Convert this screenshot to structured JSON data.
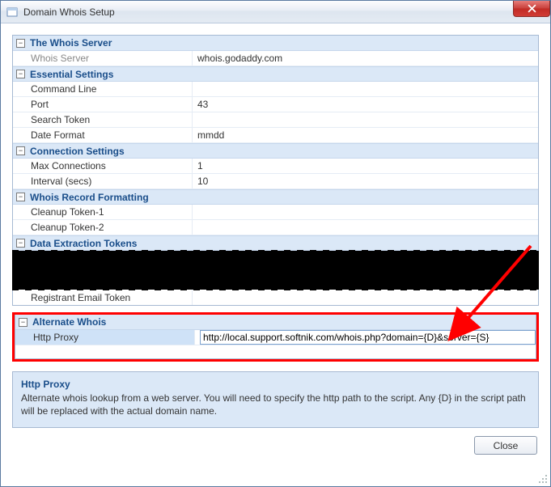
{
  "window": {
    "title": "Domain Whois Setup",
    "close_label": "Close"
  },
  "groups": {
    "whois_server": {
      "title": "The Whois Server",
      "rows": {
        "whois_server": {
          "label": "Whois Server",
          "value": "whois.godaddy.com"
        }
      }
    },
    "essential": {
      "title": "Essential Settings",
      "rows": {
        "command_line": {
          "label": "Command Line",
          "value": ""
        },
        "port": {
          "label": "Port",
          "value": "43"
        },
        "search_token": {
          "label": "Search Token",
          "value": ""
        },
        "date_format": {
          "label": "Date Format",
          "value": "mmdd"
        }
      }
    },
    "connection": {
      "title": "Connection Settings",
      "rows": {
        "max_connections": {
          "label": "Max Connections",
          "value": "1"
        },
        "interval": {
          "label": "Interval (secs)",
          "value": "10"
        }
      }
    },
    "formatting": {
      "title": "Whois Record Formatting",
      "rows": {
        "cleanup1": {
          "label": "Cleanup Token-1",
          "value": ""
        },
        "cleanup2": {
          "label": "Cleanup Token-2",
          "value": ""
        }
      }
    },
    "extraction": {
      "title": "Data Extraction Tokens",
      "rows": {
        "registrant_email": {
          "label": "Registrant Email Token",
          "value": ""
        }
      }
    },
    "alternate": {
      "title": "Alternate Whois",
      "rows": {
        "http_proxy": {
          "label": "Http Proxy",
          "value": "http://local.support.softnik.com/whois.php?domain={D}&server={S}"
        }
      }
    }
  },
  "description": {
    "title": "Http Proxy",
    "text": "Alternate whois lookup from a web server. You will need to specify the http path to the script. Any {D} in the script path will be replaced with the actual domain name."
  },
  "buttons": {
    "close": "Close"
  }
}
